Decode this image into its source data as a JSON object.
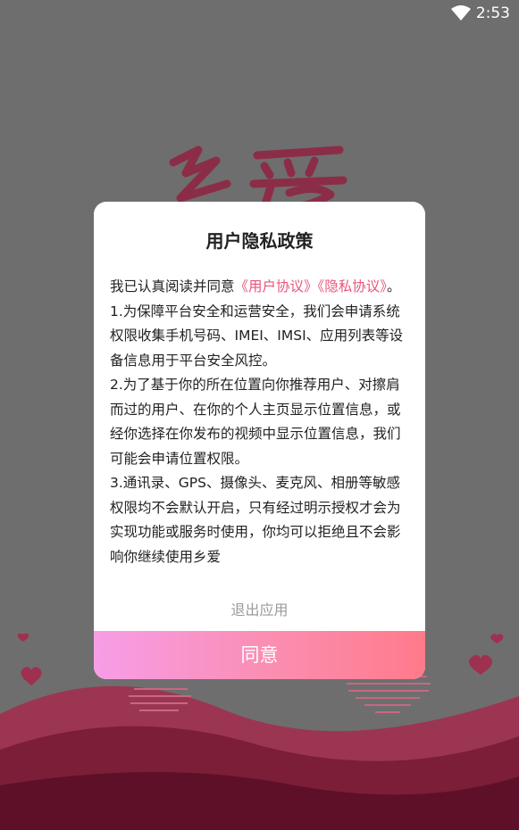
{
  "status_bar": {
    "time": "2:53",
    "wifi_icon": "wifi-icon"
  },
  "background": {
    "logo_text": "乡爱"
  },
  "dialog": {
    "title": "用户隐私政策",
    "intro_prefix": "我已认真阅读并同意",
    "user_agreement_link": "《用户协议》",
    "privacy_agreement_link": "《隐私协议》",
    "intro_suffix": "。",
    "paragraphs": [
      "1.为保障平台安全和运营安全，我们会申请系统权限收集手机号码、IMEI、IMSI、应用列表等设备信息用于平台安全风控。",
      "2.为了基于你的所在位置向你推荐用户、对擦肩而过的用户、在你的个人主页显示位置信息，或经你选择在你发布的视频中显示位置信息，我们可能会申请位置权限。",
      "3.通讯录、GPS、摄像头、麦克风、相册等敏感权限均不会默认开启，只有经过明示授权才会为实现功能或服务时使用，你均可以拒绝且不会影响你继续使用乡爱"
    ],
    "exit_label": "退出应用",
    "agree_label": "同意"
  },
  "colors": {
    "link": "#e8557c",
    "agree_gradient_start": "#f79de7",
    "agree_gradient_end": "#ff7a8a"
  }
}
